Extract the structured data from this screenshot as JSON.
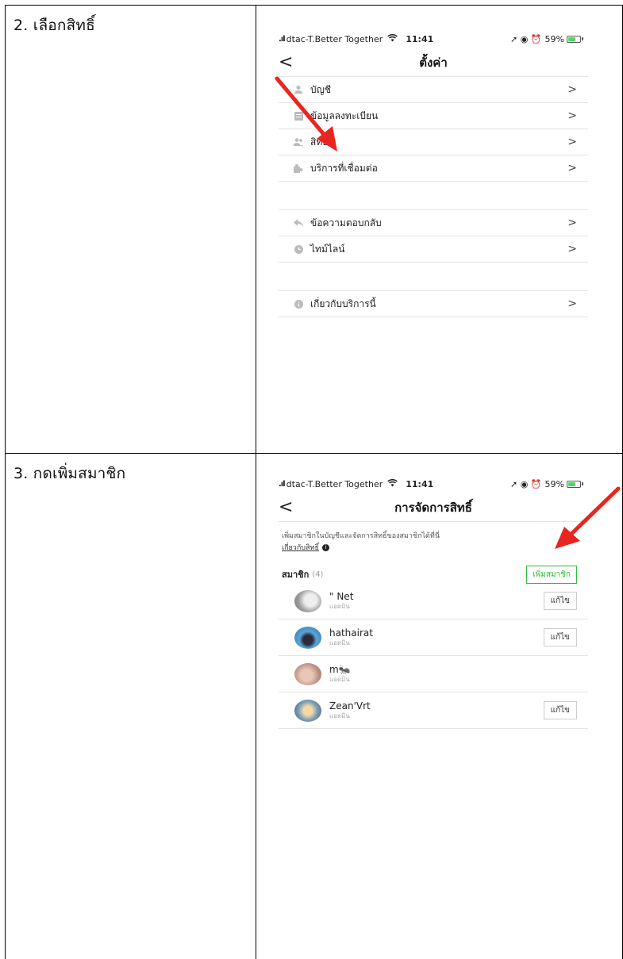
{
  "steps": {
    "step2": "2. เลือกสิทธิ์",
    "step3": "3. กดเพิ่มสมาชิก"
  },
  "status_bar": {
    "carrier": "dtac-T.Better Together",
    "time": "11:41",
    "battery": "59%",
    "battery_level": 0.59
  },
  "settings_screen": {
    "title": "ตั้งค่า",
    "group1": [
      {
        "label": "บัญชี",
        "icon": "person-icon"
      },
      {
        "label": "ข้อมูลลงทะเบียน",
        "icon": "document-icon"
      },
      {
        "label": "สิทธิ์",
        "icon": "people-icon"
      },
      {
        "label": "บริการที่เชื่อมต่อ",
        "icon": "puzzle-icon"
      }
    ],
    "group2": [
      {
        "label": "ข้อความตอบกลับ",
        "icon": "reply-icon"
      },
      {
        "label": "ไทม์ไลน์",
        "icon": "clock-icon"
      }
    ],
    "group3": [
      {
        "label": "เกี่ยวกับบริการนี้",
        "icon": "info-icon"
      }
    ]
  },
  "permissions_screen": {
    "title": "การจัดการสิทธิ์",
    "intro": "เพิ่มสมาชิกในบัญชีและจัดการสิทธิ์ของสมาชิกได้ที่นี่",
    "about_link": "เกี่ยวกับสิทธิ์",
    "members_label": "สมาชิก",
    "members_count": "(4)",
    "add_member_button": "เพิ่มสมาชิก",
    "members": [
      {
        "name": "\" Net",
        "role": "แอดมิน",
        "edit": "แก้ไข"
      },
      {
        "name": "hathairat",
        "role": "แอดมิน",
        "edit": "แก้ไข"
      },
      {
        "name": "m🐜",
        "role": "แอดมิน",
        "edit": ""
      },
      {
        "name": "Zean'Vrt",
        "role": "แอดมิน",
        "edit": "แก้ไข"
      }
    ]
  },
  "colors": {
    "arrow": "#e8251f",
    "add_button": "#2ebd3b"
  }
}
